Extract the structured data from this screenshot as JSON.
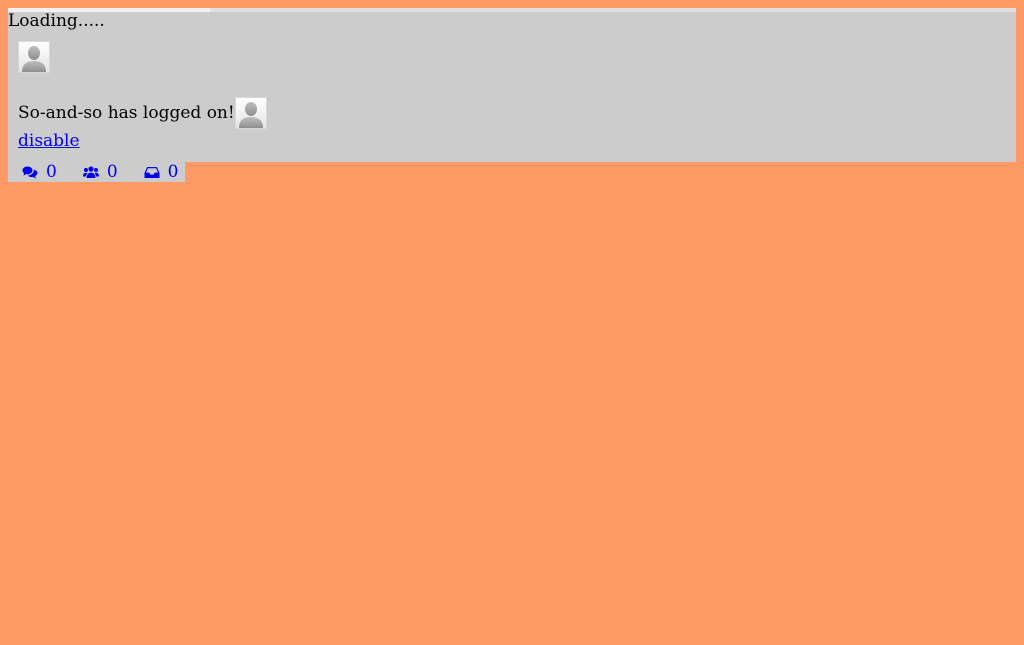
{
  "loader": {
    "text": "Loading.....",
    "progress": 0.2
  },
  "notification": {
    "message": "So-and-so has logged on!",
    "disable_label": "disable"
  },
  "status_bar": {
    "chat_count": "0",
    "users_count": "0",
    "inbox_count": "0"
  },
  "icons": {
    "chat": "comments-icon",
    "users": "users-icon",
    "inbox": "inbox-icon",
    "avatar": "user-avatar-icon"
  },
  "colors": {
    "page_background": "#ff9966",
    "panel_background": "#cccccc",
    "link": "#0000ee"
  }
}
